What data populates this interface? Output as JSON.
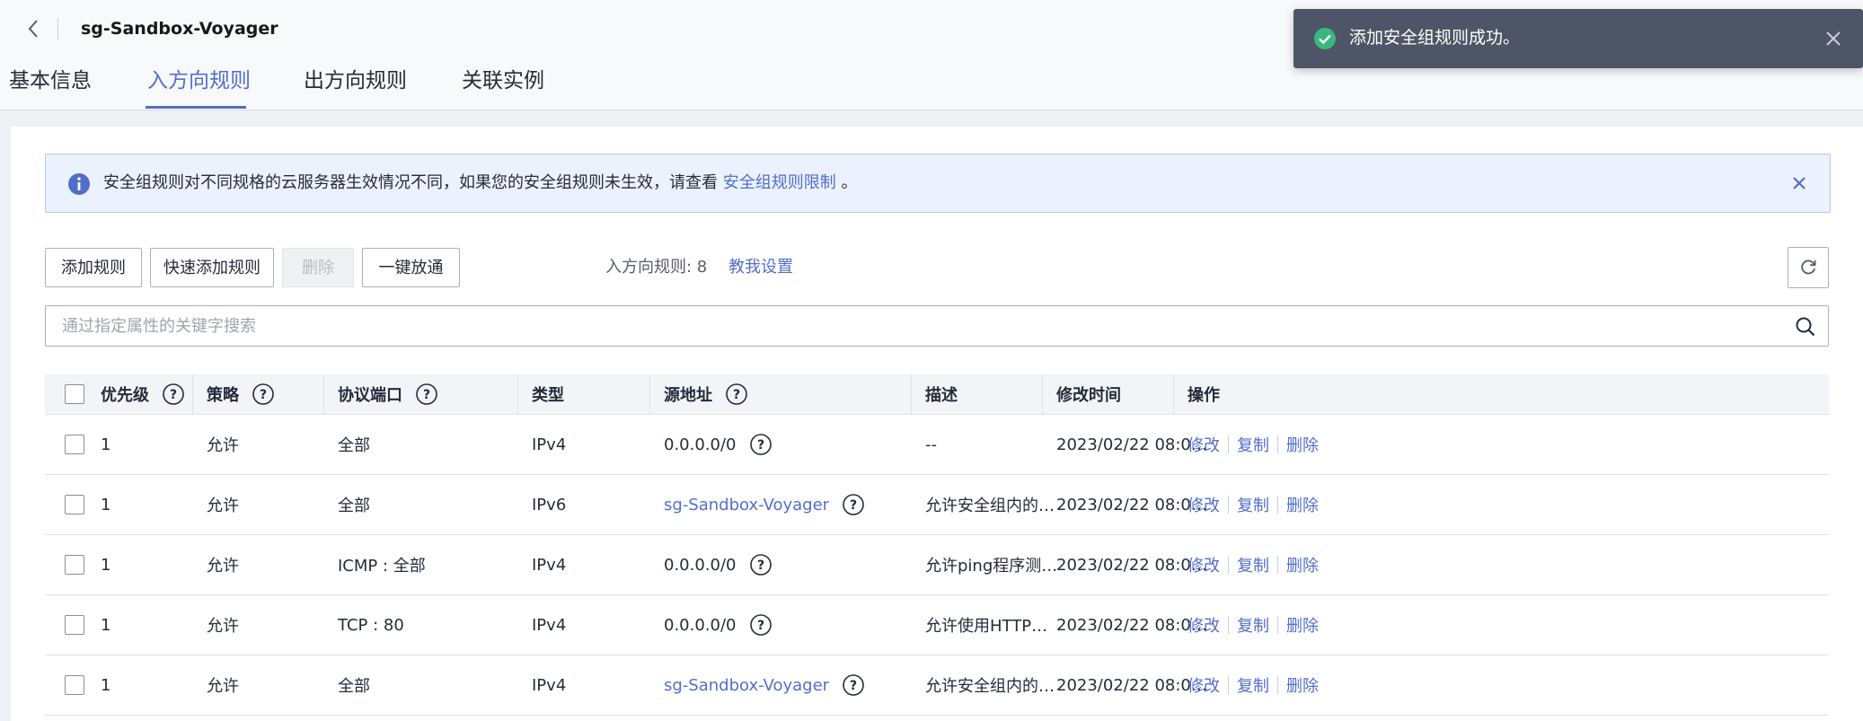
{
  "header": {
    "title": "sg-Sandbox-Voyager",
    "tabs": [
      {
        "label": "基本信息"
      },
      {
        "label": "入方向规则"
      },
      {
        "label": "出方向规则"
      },
      {
        "label": "关联实例"
      }
    ],
    "active_tab": "入方向规则"
  },
  "toast": {
    "message": "添加安全组规则成功。",
    "type": "success"
  },
  "banner": {
    "text": "安全组规则对不同规格的云服务器生效情况不同，如果您的安全组规则未生效，请查看",
    "link": "安全组规则限制",
    "suffix": "。"
  },
  "toolbar": {
    "add_rule": "添加规则",
    "quick_add_rule": "快速添加规则",
    "delete": "删除",
    "one_click_allow": "一键放通",
    "inbound_count_label": "入方向规则: 8",
    "help_link": "教我设置"
  },
  "search": {
    "placeholder": "通过指定属性的关键字搜索",
    "value": ""
  },
  "table": {
    "columns": [
      "优先级",
      "策略",
      "协议端口",
      "类型",
      "源地址",
      "描述",
      "修改时间",
      "操作"
    ],
    "rows": [
      {
        "priority": "1",
        "policy": "允许",
        "protocol_port": "全部",
        "type": "IPv4",
        "source": "0.0.0.0/0",
        "source_is_link": false,
        "description": "--",
        "modified": "2023/02/22 08:0…"
      },
      {
        "priority": "1",
        "policy": "允许",
        "protocol_port": "全部",
        "type": "IPv6",
        "source": "sg-Sandbox-Voyager",
        "source_is_link": true,
        "description": "允许安全组内的…",
        "modified": "2023/02/22 08:0…"
      },
      {
        "priority": "1",
        "policy": "允许",
        "protocol_port": "ICMP : 全部",
        "type": "IPv4",
        "source": "0.0.0.0/0",
        "source_is_link": false,
        "description": "允许ping程序测…",
        "modified": "2023/02/22 08:0…"
      },
      {
        "priority": "1",
        "policy": "允许",
        "protocol_port": "TCP : 80",
        "type": "IPv4",
        "source": "0.0.0.0/0",
        "source_is_link": false,
        "description": "允许使用HTTP…",
        "modified": "2023/02/22 08:0…"
      },
      {
        "priority": "1",
        "policy": "允许",
        "protocol_port": "全部",
        "type": "IPv4",
        "source": "sg-Sandbox-Voyager",
        "source_is_link": true,
        "description": "允许安全组内的…",
        "modified": "2023/02/22 08:0…"
      }
    ],
    "actions": {
      "modify": "修改",
      "copy": "复制",
      "delete": "删除"
    }
  },
  "colors": {
    "accent": "#526ecc",
    "success": "#3bb77e",
    "toast_bg": "#4e5566",
    "banner_bg": "#ebf2fd"
  }
}
